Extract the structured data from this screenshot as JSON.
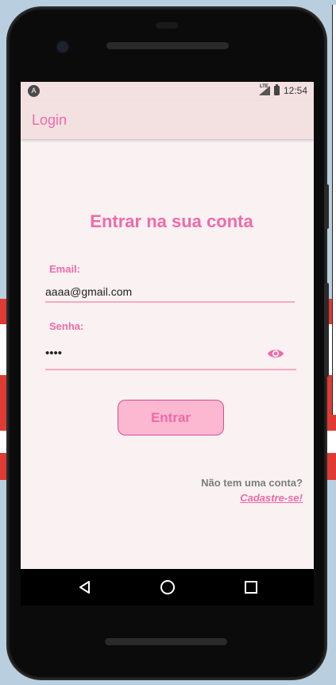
{
  "status_bar": {
    "left_icon": "android-notification-icon",
    "network": "LTE",
    "time": "12:54"
  },
  "app_bar": {
    "title": "Login"
  },
  "form": {
    "heading": "Entrar na sua conta",
    "email_label": "Email:",
    "email_value": "aaaa@gmail.com",
    "password_label": "Senha:",
    "password_value": "••••",
    "show_password_icon": "eye-icon",
    "submit_label": "Entrar"
  },
  "footer": {
    "no_account_text": "Não tem uma conta?",
    "signup_link": "Cadastre-se!"
  },
  "nav_bar": {
    "icons": [
      "back-icon",
      "home-icon",
      "recents-icon"
    ]
  },
  "colors": {
    "accent": "#f06aa8",
    "button_bg": "#fbb8d0",
    "screen_bg": "#f9f1f2",
    "appbar_bg": "#f3e1e2"
  }
}
